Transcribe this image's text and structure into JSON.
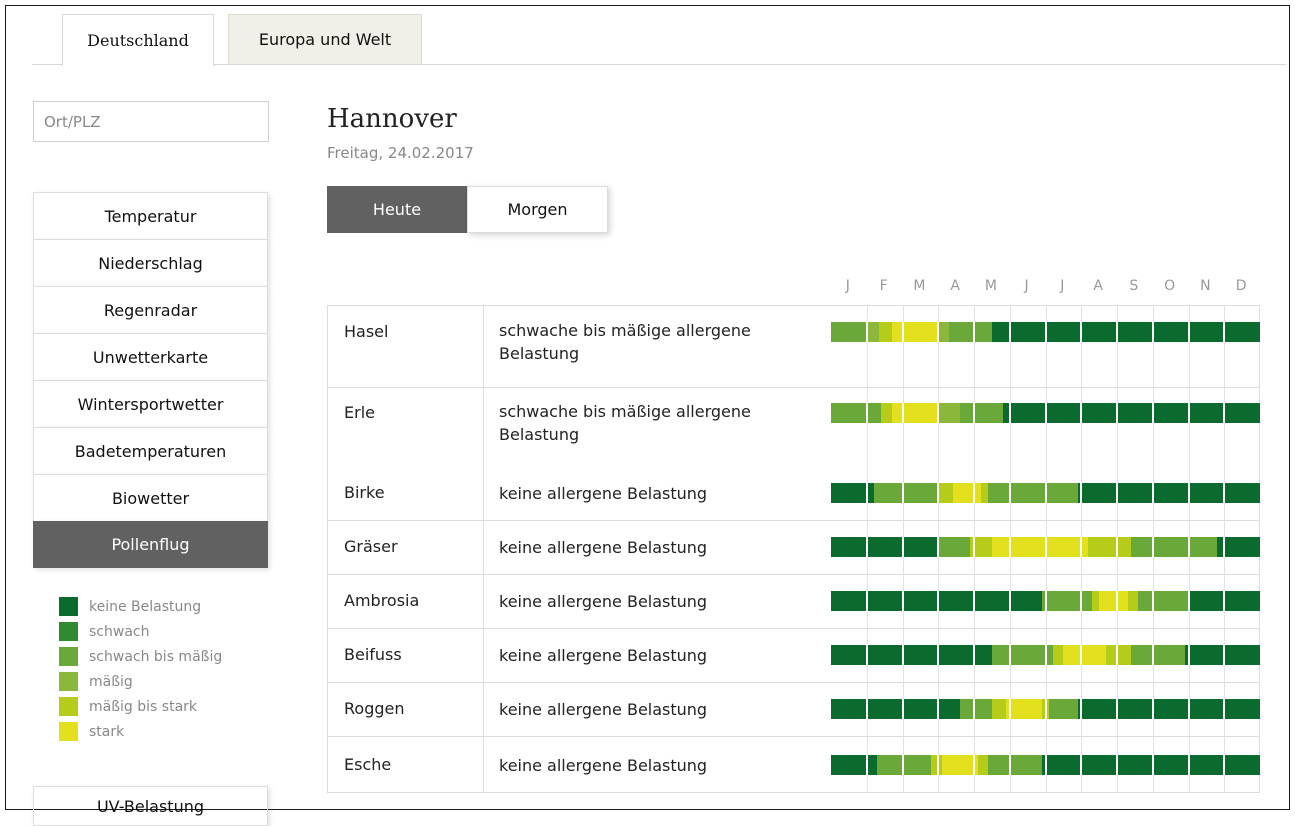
{
  "tabs": [
    "Deutschland",
    "Europa und Welt"
  ],
  "search": {
    "placeholder": "Ort/PLZ"
  },
  "menu": [
    "Temperatur",
    "Niederschlag",
    "Regenradar",
    "Unwetterkarte",
    "Wintersportwetter",
    "Badetemperaturen",
    "Biowetter",
    "Pollenflug"
  ],
  "menu_active": "Pollenflug",
  "menu_more": "UV-Belastung",
  "legend": [
    {
      "label": "keine Belastung",
      "color": "#0b6b2f"
    },
    {
      "label": "schwach",
      "color": "#2e8b34"
    },
    {
      "label": "schwach bis mäßig",
      "color": "#6aa83a"
    },
    {
      "label": "mäßig",
      "color": "#8bb83a"
    },
    {
      "label": "mäßig bis stark",
      "color": "#b6cc1a"
    },
    {
      "label": "stark",
      "color": "#e3e11e"
    }
  ],
  "main": {
    "city": "Hannover",
    "date": "Freitag, 24.02.2017",
    "buttons": [
      "Heute",
      "Morgen"
    ],
    "active_button": "Heute",
    "months": [
      "J",
      "F",
      "M",
      "A",
      "M",
      "J",
      "J",
      "A",
      "S",
      "O",
      "N",
      "D"
    ],
    "rows": [
      {
        "name": "Hasel",
        "desc": "schwache bis mäßige allergene Belastung",
        "timeline": [
          [
            0,
            1,
            "schwach bis mäßig"
          ],
          [
            1,
            1.35,
            "mäßig"
          ],
          [
            1.35,
            1.7,
            "mäßig bis stark"
          ],
          [
            1.7,
            3,
            "stark"
          ],
          [
            3,
            3.3,
            "mäßig"
          ],
          [
            3.3,
            4.5,
            "schwach bis mäßig"
          ],
          [
            4.5,
            12,
            "keine Belastung"
          ]
        ]
      },
      {
        "name": "Erle",
        "desc": "schwache bis mäßige allergene Belastung",
        "timeline": [
          [
            0,
            1.4,
            "schwach bis mäßig"
          ],
          [
            1.4,
            1.7,
            "mäßig bis stark"
          ],
          [
            1.7,
            3,
            "stark"
          ],
          [
            3,
            3.6,
            "mäßig"
          ],
          [
            3.6,
            4.8,
            "schwach bis mäßig"
          ],
          [
            4.8,
            12,
            "keine Belastung"
          ]
        ]
      },
      {
        "name": "Birke",
        "desc": "keine allergene Belastung",
        "timeline": [
          [
            0,
            1.2,
            "keine Belastung"
          ],
          [
            1.2,
            3,
            "schwach bis mäßig"
          ],
          [
            3,
            3.4,
            "mäßig bis stark"
          ],
          [
            3.4,
            4.2,
            "stark"
          ],
          [
            4.2,
            4.4,
            "mäßig bis stark"
          ],
          [
            4.4,
            6.9,
            "schwach bis mäßig"
          ],
          [
            6.9,
            12,
            "keine Belastung"
          ]
        ]
      },
      {
        "name": "Gräser",
        "desc": "keine allergene Belastung",
        "timeline": [
          [
            0,
            3,
            "keine Belastung"
          ],
          [
            3,
            3.9,
            "schwach bis mäßig"
          ],
          [
            3.9,
            4.5,
            "mäßig bis stark"
          ],
          [
            4.5,
            7.2,
            "stark"
          ],
          [
            7.2,
            8.4,
            "mäßig bis stark"
          ],
          [
            8.4,
            10.8,
            "schwach bis mäßig"
          ],
          [
            10.8,
            12,
            "keine Belastung"
          ]
        ]
      },
      {
        "name": "Ambrosia",
        "desc": "keine allergene Belastung",
        "timeline": [
          [
            0,
            5.9,
            "keine Belastung"
          ],
          [
            5.9,
            7.3,
            "schwach bis mäßig"
          ],
          [
            7.3,
            7.5,
            "mäßig bis stark"
          ],
          [
            7.5,
            8.3,
            "stark"
          ],
          [
            8.3,
            8.6,
            "mäßig bis stark"
          ],
          [
            8.6,
            10,
            "schwach bis mäßig"
          ],
          [
            10,
            12,
            "keine Belastung"
          ]
        ]
      },
      {
        "name": "Beifuss",
        "desc": "keine allergene Belastung",
        "timeline": [
          [
            0,
            4.5,
            "keine Belastung"
          ],
          [
            4.5,
            6.2,
            "schwach bis mäßig"
          ],
          [
            6.2,
            6.5,
            "mäßig bis stark"
          ],
          [
            6.5,
            7.7,
            "stark"
          ],
          [
            7.7,
            8.4,
            "mäßig bis stark"
          ],
          [
            8.4,
            9.9,
            "schwach bis mäßig"
          ],
          [
            9.9,
            12,
            "keine Belastung"
          ]
        ]
      },
      {
        "name": "Roggen",
        "desc": "keine allergene Belastung",
        "timeline": [
          [
            0,
            3.6,
            "keine Belastung"
          ],
          [
            3.6,
            4.5,
            "schwach bis mäßig"
          ],
          [
            4.5,
            4.9,
            "mäßig bis stark"
          ],
          [
            4.9,
            5.9,
            "stark"
          ],
          [
            5.9,
            6.1,
            "mäßig bis stark"
          ],
          [
            6.1,
            6.9,
            "schwach bis mäßig"
          ],
          [
            6.9,
            12,
            "keine Belastung"
          ]
        ]
      },
      {
        "name": "Esche",
        "desc": "keine allergene Belastung",
        "timeline": [
          [
            0,
            1.3,
            "keine Belastung"
          ],
          [
            1.3,
            2.8,
            "schwach bis mäßig"
          ],
          [
            2.8,
            3.1,
            "mäßig bis stark"
          ],
          [
            3.1,
            4.1,
            "stark"
          ],
          [
            4.1,
            4.4,
            "mäßig bis stark"
          ],
          [
            4.4,
            5.9,
            "schwach bis mäßig"
          ],
          [
            5.9,
            12,
            "keine Belastung"
          ]
        ]
      }
    ]
  }
}
